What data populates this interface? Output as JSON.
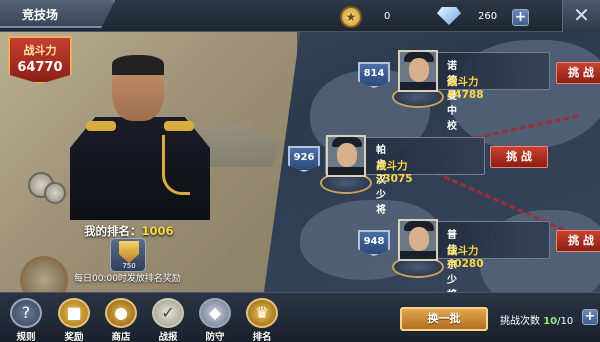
{
  "header": {
    "title": "竞技场",
    "medal_count": "0",
    "gem_count": "260",
    "plus_label": "+",
    "close_label": "✕"
  },
  "player": {
    "power_label": "战斗力",
    "power_value": "64770",
    "rank_label": "我的排名：",
    "rank_value": "1006",
    "reward_count": "750",
    "reward_note": "每日00:00时发放排名奖励"
  },
  "opponents": [
    {
      "rank": "814",
      "name": "诺德曼中校",
      "power": "战斗力 44788",
      "challenge": "挑 战"
    },
    {
      "rank": "926",
      "name": "帕肯汉少将",
      "power": "战斗力 23075",
      "challenge": "挑 战"
    },
    {
      "rank": "948",
      "name": "普佳京少将",
      "power": "战斗力 40280",
      "challenge": "挑 战"
    }
  ],
  "nav": [
    {
      "label": "规则",
      "icon": "question-icon"
    },
    {
      "label": "奖励",
      "icon": "treasure-chest-icon"
    },
    {
      "label": "商店",
      "icon": "shop-icon"
    },
    {
      "label": "战报",
      "icon": "clipboard-icon"
    },
    {
      "label": "防守",
      "icon": "shield-icon"
    },
    {
      "label": "排名",
      "icon": "trophy-icon"
    }
  ],
  "footer": {
    "refresh_label": "换一批",
    "tries_label": "挑战次数",
    "tries_value": "10",
    "tries_max": "/10",
    "plus_label": "+"
  },
  "colors": {
    "challenge_red": "#b8321f",
    "accent_gold": "#ffd84a",
    "tries_green": "#8ef26c"
  }
}
